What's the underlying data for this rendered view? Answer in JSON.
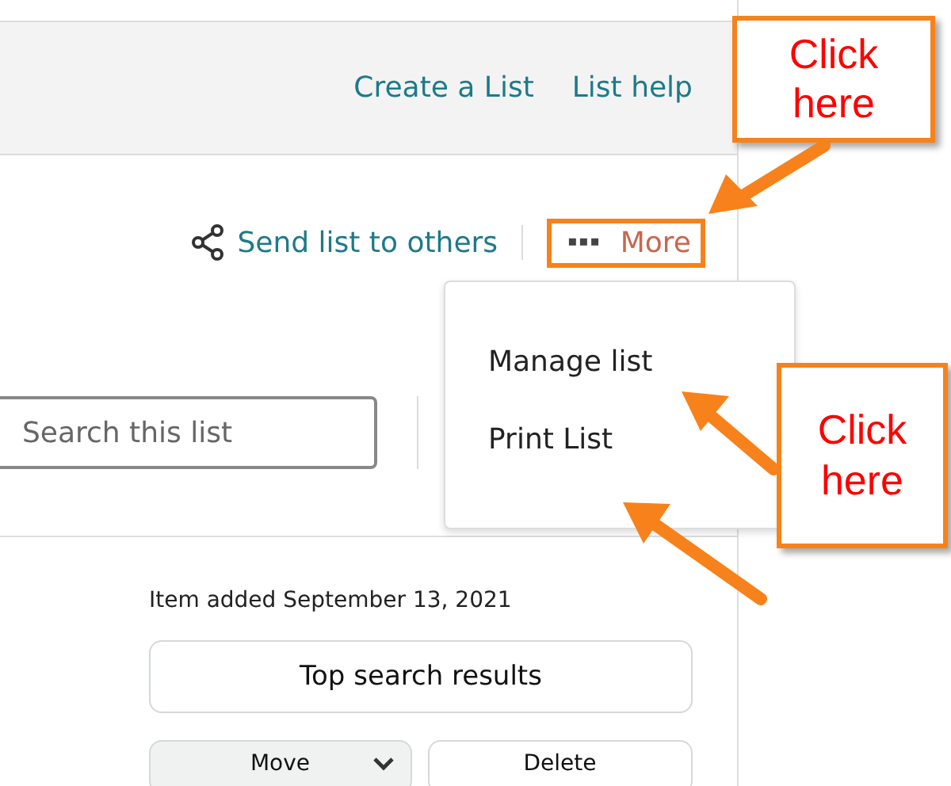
{
  "header": {
    "links": [
      "Create a List",
      "List help"
    ]
  },
  "toolbar": {
    "share_link": "Send list to others",
    "more_icon": "▪▪▪",
    "more_button": "More"
  },
  "menu": {
    "items": [
      "Manage list",
      "Print List"
    ]
  },
  "search": {
    "placeholder": "Search this list"
  },
  "item": {
    "added": "Item added September 13, 2021",
    "search_button": "Top search results",
    "move_button": "Move",
    "delete_button": "Delete"
  },
  "callouts": [
    {
      "text": "Click here"
    },
    {
      "text": "Click here"
    }
  ]
}
